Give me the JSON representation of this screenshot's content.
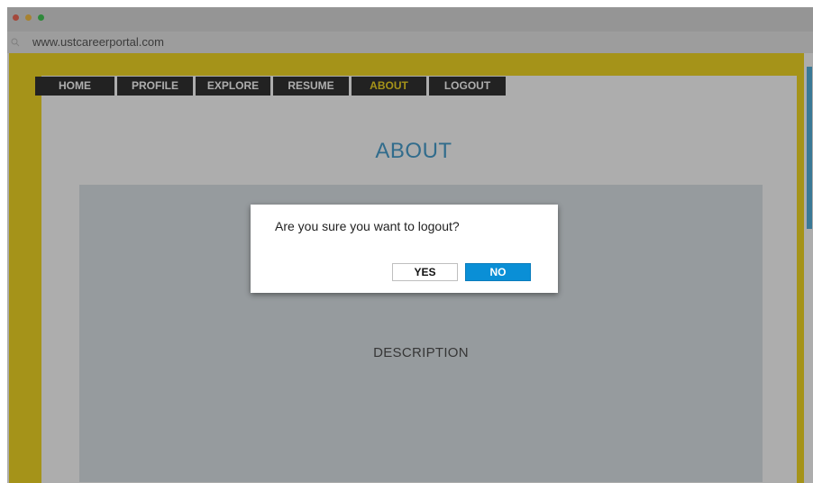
{
  "browser": {
    "url": "www.ustcareerportal.com"
  },
  "nav": {
    "items": [
      {
        "label": "HOME",
        "active": false
      },
      {
        "label": "PROFILE",
        "active": false
      },
      {
        "label": "EXPLORE",
        "active": false
      },
      {
        "label": "RESUME",
        "active": false
      },
      {
        "label": "ABOUT",
        "active": true
      },
      {
        "label": "LOGOUT",
        "active": false
      }
    ]
  },
  "page": {
    "title": "ABOUT",
    "description_label": "DESCRIPTION"
  },
  "dialog": {
    "message": "Are you sure you want to logout?",
    "yes_label": "YES",
    "no_label": "NO"
  },
  "colors": {
    "frame": "#f2d200",
    "nav_background": "#111111",
    "nav_active_text": "#f2d200",
    "title": "#2a8fc6",
    "primary_button": "#0a8fd6",
    "panel": "#d8e0e6"
  }
}
